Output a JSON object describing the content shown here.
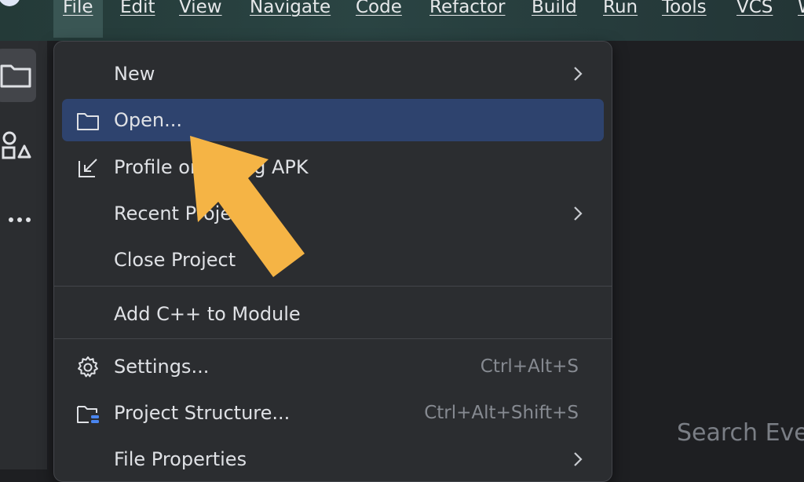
{
  "menubar": {
    "items": [
      {
        "label": "File",
        "active": true
      },
      {
        "label": "Edit"
      },
      {
        "label": "View"
      },
      {
        "label": "Navigate"
      },
      {
        "label": "Code"
      },
      {
        "label": "Refactor"
      },
      {
        "label": "Build"
      },
      {
        "label": "Run"
      },
      {
        "label": "Tools"
      },
      {
        "label": "VCS"
      },
      {
        "label": "W"
      }
    ]
  },
  "sidebar": {
    "icons": [
      "project-folder-icon",
      "resource-manager-icon",
      "more-options-icon"
    ]
  },
  "file_menu": {
    "items": [
      {
        "label": "New",
        "icon": "",
        "shortcut": "",
        "submenu": true
      },
      {
        "label": "Open...",
        "icon": "folder-icon",
        "shortcut": "",
        "submenu": false,
        "selected": true
      },
      {
        "label": "Profile or Debug APK",
        "icon": "import-arrow-icon",
        "shortcut": "",
        "submenu": false
      },
      {
        "label": "Recent Projects",
        "icon": "",
        "shortcut": "",
        "submenu": true
      },
      {
        "label": "Close Project",
        "icon": "",
        "shortcut": "",
        "submenu": false
      },
      {
        "label": "Add C++ to Module",
        "icon": "",
        "shortcut": "",
        "submenu": false
      },
      {
        "label": "Settings...",
        "icon": "gear-icon",
        "shortcut": "Ctrl+Alt+S",
        "submenu": false
      },
      {
        "label": "Project Structure...",
        "icon": "project-structure-icon",
        "shortcut": "Ctrl+Alt+Shift+S",
        "submenu": false
      },
      {
        "label": "File Properties",
        "icon": "",
        "shortcut": "",
        "submenu": true
      }
    ]
  },
  "editor": {
    "search_hint": "Search Eve"
  },
  "colors": {
    "menu_bg": "#2b2d30",
    "selection": "#2e436e",
    "annotation_arrow": "#f5b445"
  }
}
